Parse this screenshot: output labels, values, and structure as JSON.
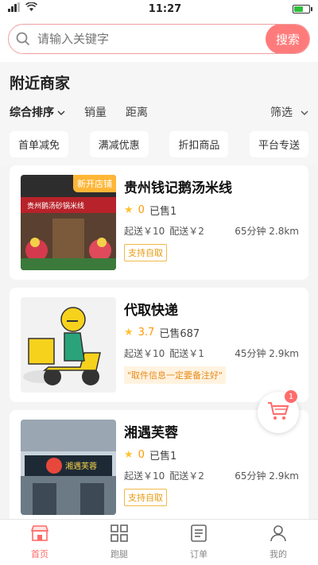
{
  "status": {
    "time": "11:27",
    "battery_level": 0.6
  },
  "search": {
    "placeholder": "请输入关键字",
    "button": "搜索"
  },
  "section": {
    "title": "附近商家"
  },
  "sort": {
    "items": [
      "综合排序",
      "销量",
      "距离"
    ],
    "filter": "筛选"
  },
  "chips": [
    "首单减免",
    "满减优惠",
    "折扣商品",
    "平台专送"
  ],
  "shops": [
    {
      "name": "贵州钱记鹅汤米线",
      "badge": "新开店铺",
      "score": "0",
      "sold": "已售1",
      "min_order": "起送￥10",
      "delivery": "配送￥2",
      "eta": "65分钟 2.8km",
      "tag": "支持自取",
      "sign_text": "贵州鹅汤砂锅米线"
    },
    {
      "name": "代取快递",
      "badge": "",
      "score": "3.7",
      "sold": "已售687",
      "min_order": "起送￥10",
      "delivery": "配送￥1",
      "eta": "45分钟 2.9km",
      "tag": "\"取件信息一定要备注好\""
    },
    {
      "name": "湘遇芙蓉",
      "badge": "",
      "score": "0",
      "sold": "已售1",
      "min_order": "起送￥10",
      "delivery": "配送￥2",
      "eta": "65分钟 2.9km",
      "tag": "支持自取",
      "sign_text": "湘遇芙蓉"
    }
  ],
  "cart": {
    "count": "1"
  },
  "tabs": [
    "首页",
    "跑腿",
    "订单",
    "我的"
  ],
  "colors": {
    "accent": "#ff7b7b",
    "star": "#ffc233",
    "tag": "#e79a10"
  }
}
